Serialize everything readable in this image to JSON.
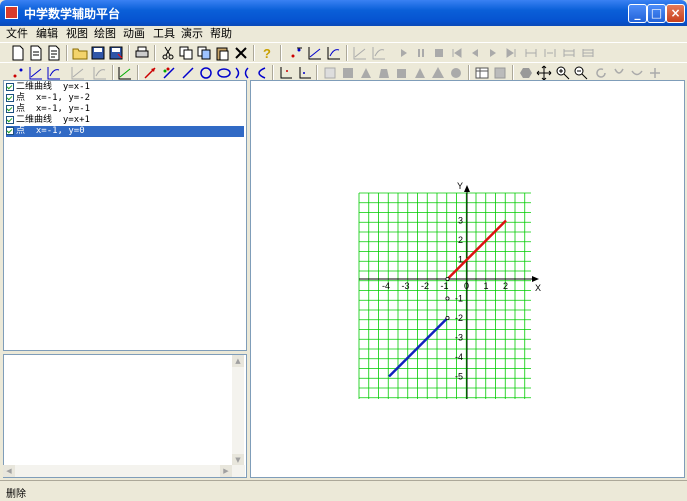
{
  "window": {
    "title": "中学数学辅助平台"
  },
  "menu": [
    "文件",
    "编辑",
    "视图",
    "绘图",
    "动画",
    "工具",
    "演示",
    "帮助"
  ],
  "object_list": [
    {
      "type": "二维曲线",
      "expr": "y=x-1",
      "checked": true,
      "selected": false
    },
    {
      "type": "点",
      "expr": "x=-1, y=-2",
      "checked": true,
      "selected": false
    },
    {
      "type": "点",
      "expr": "x=-1, y=-1",
      "checked": true,
      "selected": false
    },
    {
      "type": "二维曲线",
      "expr": "y=x+1",
      "checked": true,
      "selected": false
    },
    {
      "type": "点",
      "expr": "x=-1, y=0",
      "checked": true,
      "selected": true
    }
  ],
  "graph": {
    "x_label": "X",
    "y_label": "Y",
    "x_ticks": [
      "-4",
      "-3",
      "-2",
      "-1",
      "0",
      "1",
      "2"
    ],
    "y_ticks": [
      "3",
      "2",
      "1",
      "-1",
      "-2",
      "-3",
      "-4",
      "-5"
    ],
    "grid_color": "#00cc00",
    "segments": [
      {
        "label": "y=x+1",
        "from": [
          -1,
          0
        ],
        "to": [
          2,
          3
        ],
        "color": "#dd1111"
      },
      {
        "label": "y=x-1",
        "from": [
          -4,
          -5
        ],
        "to": [
          -1,
          -2
        ],
        "color": "#1122bb"
      }
    ],
    "points": [
      {
        "x": -1,
        "y": 0
      },
      {
        "x": -1,
        "y": -2
      },
      {
        "x": -1,
        "y": -1
      }
    ]
  },
  "status": {
    "text": "删除"
  },
  "colors": {
    "selection": "#316ac5",
    "title_bar": "#0a5fd8"
  }
}
